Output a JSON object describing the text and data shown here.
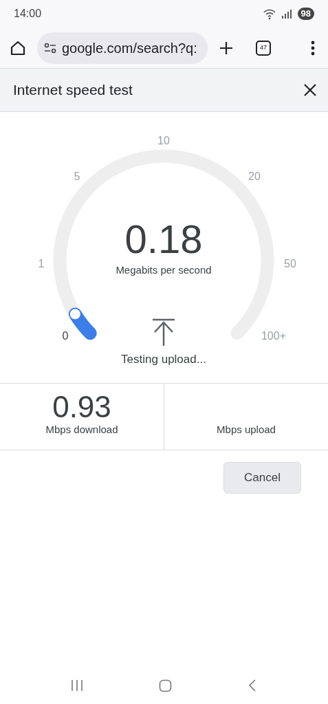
{
  "status_bar": {
    "time": "14:00",
    "battery": "98"
  },
  "browser": {
    "url": "google.com/search?q:",
    "tab_count": "47"
  },
  "dialog": {
    "title": "Internet speed test"
  },
  "gauge": {
    "ticks": [
      "10",
      "5",
      "20",
      "1",
      "50",
      "0",
      "100+"
    ],
    "value": "0.18",
    "unit": "Megabits per second"
  },
  "status_text": "Testing upload...",
  "results": [
    {
      "value": "0.93",
      "label": "Mbps download"
    },
    {
      "label": "Mbps upload"
    }
  ],
  "cancel_button": "Cancel"
}
